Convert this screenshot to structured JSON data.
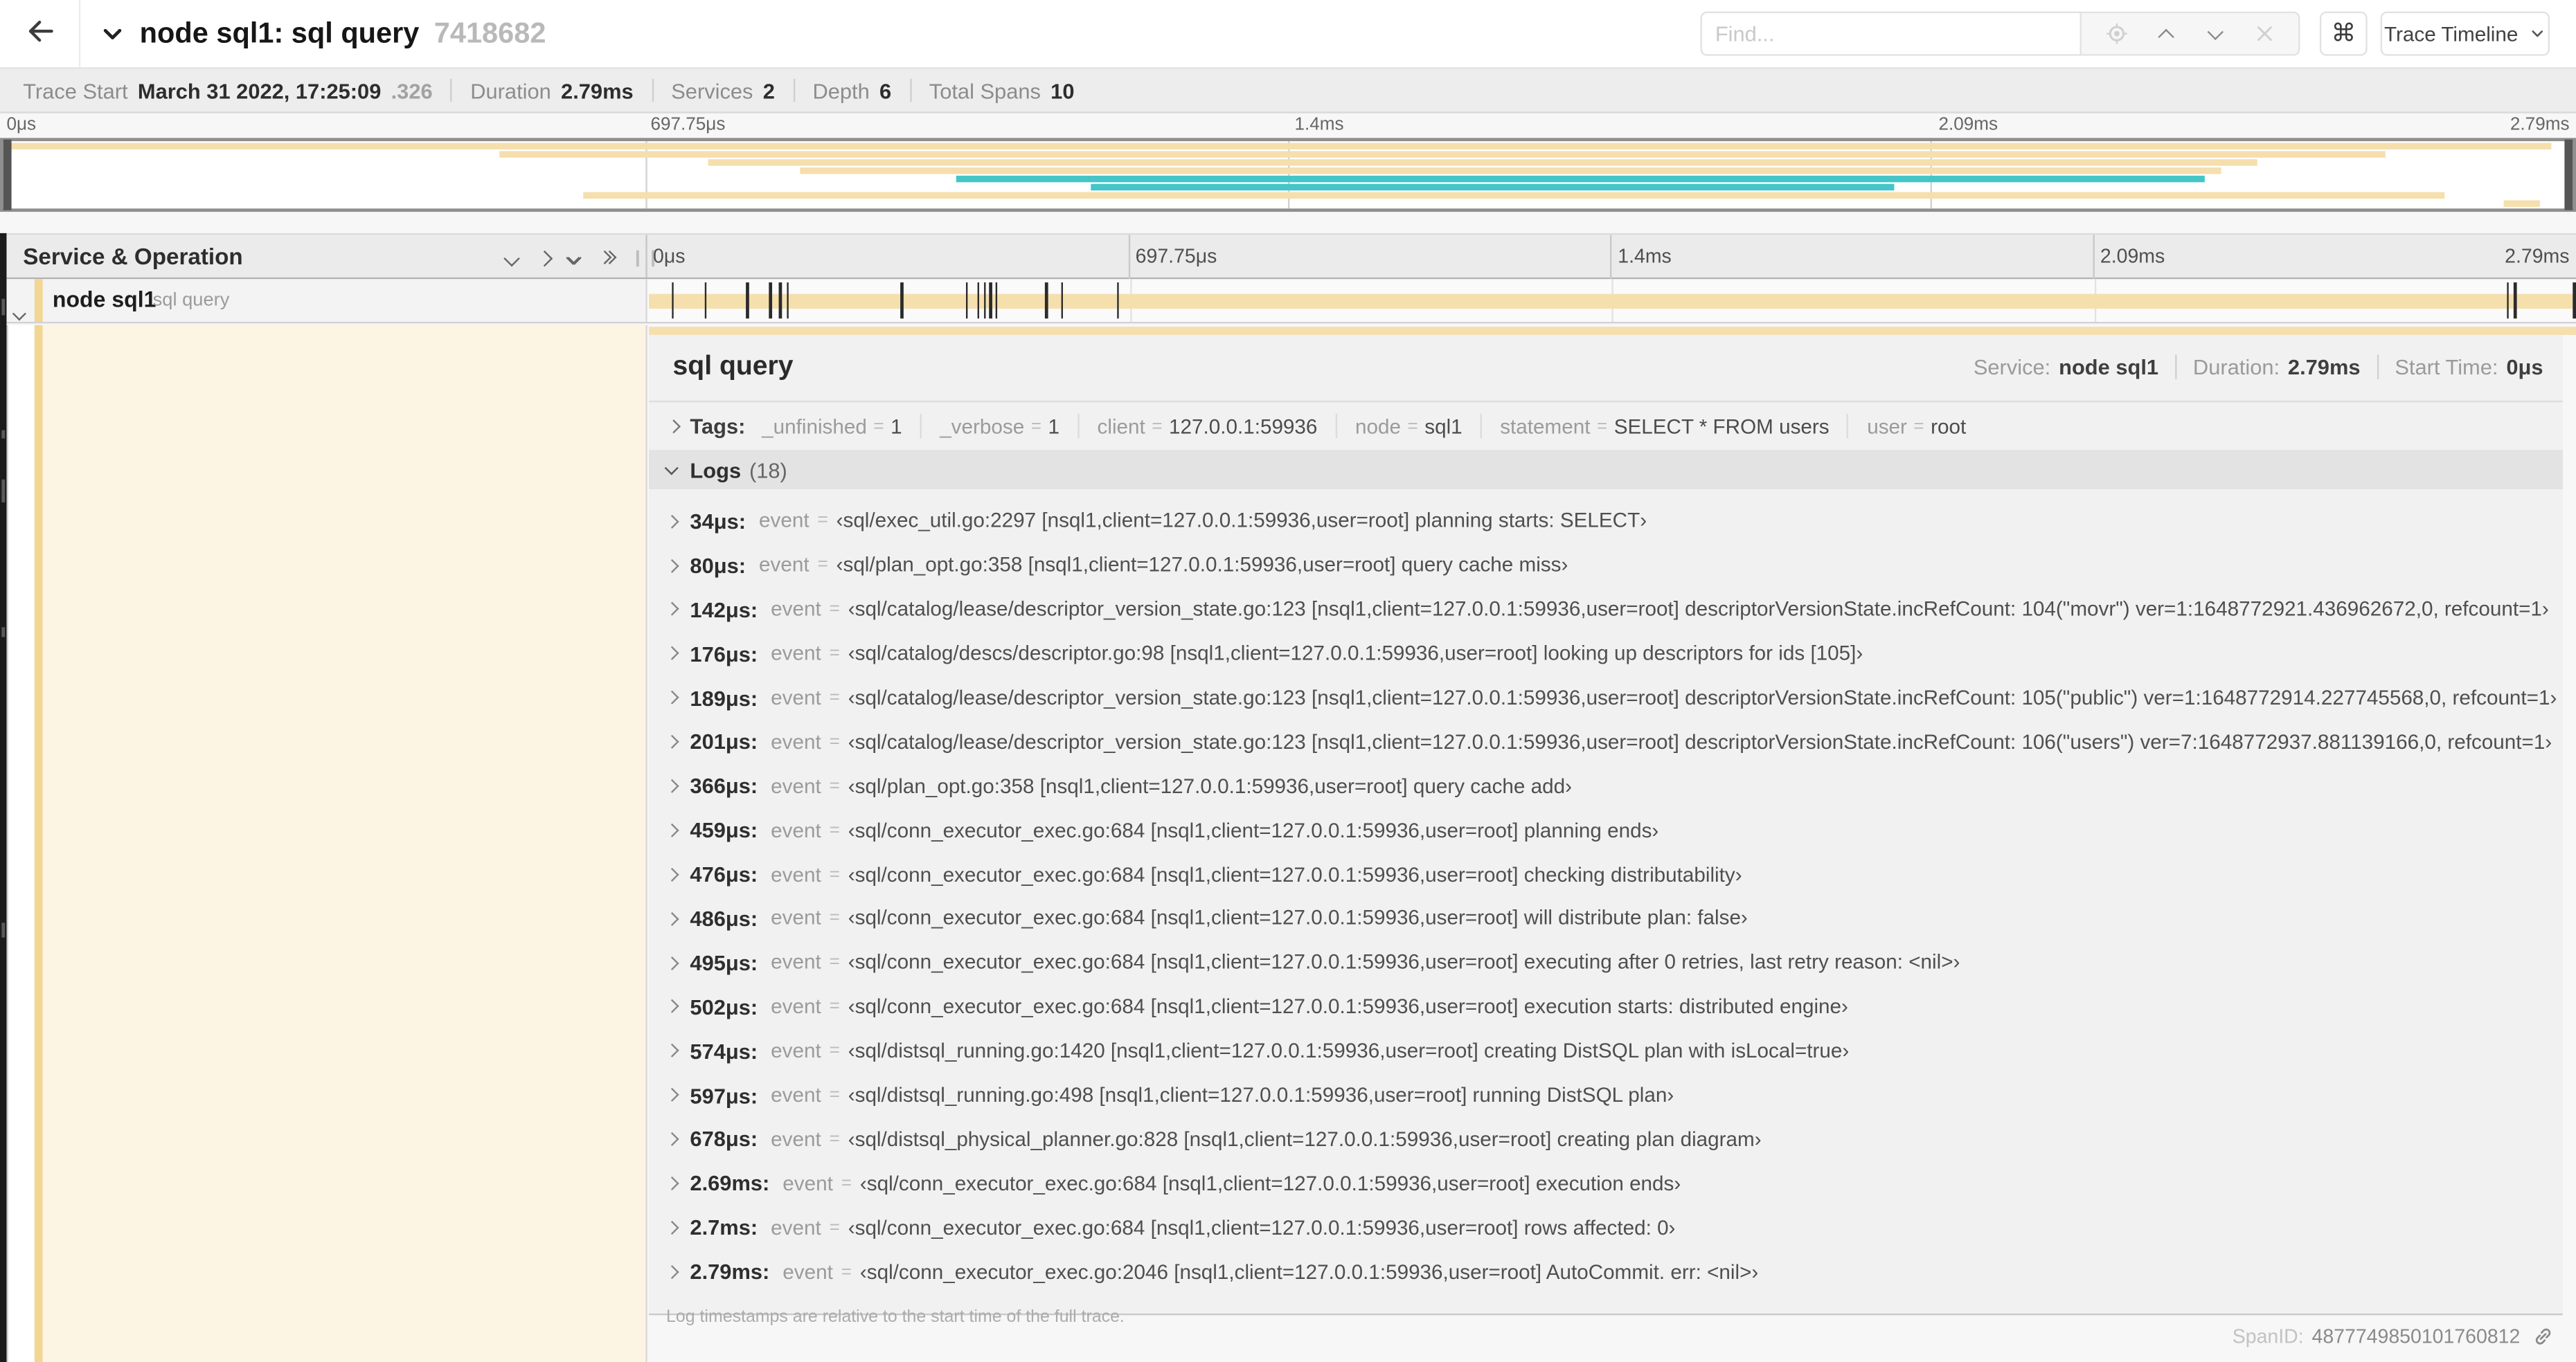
{
  "header": {
    "title": "node sql1: sql query",
    "trace_id_short": "7418682",
    "find_placeholder": "Find...",
    "shortcut_button": "⌘",
    "view_button": "Trace Timeline"
  },
  "summary": {
    "items": [
      {
        "label": "Trace Start",
        "value": "March 31 2022, 17:25:09",
        "suffix": ".326"
      },
      {
        "label": "Duration",
        "value": "2.79ms"
      },
      {
        "label": "Services",
        "value": "2"
      },
      {
        "label": "Depth",
        "value": "6"
      },
      {
        "label": "Total Spans",
        "value": "10"
      }
    ]
  },
  "ruler": {
    "ticks": [
      {
        "label": "0μs",
        "pct": 0
      },
      {
        "label": "697.75μs",
        "pct": 25
      },
      {
        "label": "1.4ms",
        "pct": 50
      },
      {
        "label": "2.09ms",
        "pct": 75
      },
      {
        "label": "2.79ms",
        "pct": 100
      }
    ]
  },
  "colors": {
    "span_tan": "#F5DFAD",
    "span_teal": "#45C5C7",
    "service_stripe": "#F2D694",
    "detail_cream": "#FDF5E3"
  },
  "minimap": {
    "bars": [
      {
        "row": 0,
        "start": 0,
        "end": 99.2,
        "color": "span_tan"
      },
      {
        "row": 1,
        "start": 19.3,
        "end": 92.7,
        "color": "span_tan"
      },
      {
        "row": 2,
        "start": 27.4,
        "end": 87.7,
        "color": "span_tan"
      },
      {
        "row": 3,
        "start": 31.0,
        "end": 86.3,
        "color": "span_tan"
      },
      {
        "row": 4,
        "start": 37.1,
        "end": 85.7,
        "color": "span_teal"
      },
      {
        "row": 5,
        "start": 42.3,
        "end": 73.6,
        "color": "span_teal"
      },
      {
        "row": 6,
        "start": 22.6,
        "end": 95.0,
        "color": "span_tan"
      },
      {
        "row": 7,
        "start": 97.3,
        "end": 98.7,
        "color": "span_tan"
      }
    ]
  },
  "columns_header": {
    "title": "Service & Operation"
  },
  "span_row": {
    "service": "node sql1",
    "operation": "sql query",
    "bar": {
      "start": 0,
      "end": 100
    },
    "log_tick_pcts": [
      1.2,
      2.9,
      5.1,
      6.3,
      6.8,
      7.2,
      13.1,
      16.5,
      17.1,
      17.4,
      17.7,
      18.0,
      20.6,
      21.4,
      24.3,
      96.4,
      96.8,
      99.85
    ]
  },
  "ui": {
    "eq": "="
  },
  "detail": {
    "title": "sql query",
    "meta": [
      {
        "label": "Service:",
        "value": "node sql1"
      },
      {
        "label": "Duration:",
        "value": "2.79ms"
      },
      {
        "label": "Start Time:",
        "value": "0μs"
      }
    ],
    "tags_label": "Tags:",
    "tags": [
      {
        "k": "_unfinished",
        "v": "1"
      },
      {
        "k": "_verbose",
        "v": "1"
      },
      {
        "k": "client",
        "v": "127.0.0.1:59936"
      },
      {
        "k": "node",
        "v": "sql1"
      },
      {
        "k": "statement",
        "v": "SELECT * FROM users"
      },
      {
        "k": "user",
        "v": "root"
      }
    ],
    "logs_label": "Logs",
    "logs_count": "(18)",
    "event_label": "event",
    "logs": [
      {
        "time": "34μs:",
        "event": "‹sql/exec_util.go:2297 [nsql1,client=127.0.0.1:59936,user=root] planning starts: SELECT›"
      },
      {
        "time": "80μs:",
        "event": "‹sql/plan_opt.go:358 [nsql1,client=127.0.0.1:59936,user=root] query cache miss›"
      },
      {
        "time": "142μs:",
        "event": "‹sql/catalog/lease/descriptor_version_state.go:123 [nsql1,client=127.0.0.1:59936,user=root] descriptorVersionState.incRefCount: 104(\"movr\") ver=1:1648772921.436962672,0, refcount=1›"
      },
      {
        "time": "176μs:",
        "event": "‹sql/catalog/descs/descriptor.go:98 [nsql1,client=127.0.0.1:59936,user=root] looking up descriptors for ids [105]›"
      },
      {
        "time": "189μs:",
        "event": "‹sql/catalog/lease/descriptor_version_state.go:123 [nsql1,client=127.0.0.1:59936,user=root] descriptorVersionState.incRefCount: 105(\"public\") ver=1:1648772914.227745568,0, refcount=1›"
      },
      {
        "time": "201μs:",
        "event": "‹sql/catalog/lease/descriptor_version_state.go:123 [nsql1,client=127.0.0.1:59936,user=root] descriptorVersionState.incRefCount: 106(\"users\") ver=7:1648772937.881139166,0, refcount=1›"
      },
      {
        "time": "366μs:",
        "event": "‹sql/plan_opt.go:358 [nsql1,client=127.0.0.1:59936,user=root] query cache add›"
      },
      {
        "time": "459μs:",
        "event": "‹sql/conn_executor_exec.go:684 [nsql1,client=127.0.0.1:59936,user=root] planning ends›"
      },
      {
        "time": "476μs:",
        "event": "‹sql/conn_executor_exec.go:684 [nsql1,client=127.0.0.1:59936,user=root] checking distributability›"
      },
      {
        "time": "486μs:",
        "event": "‹sql/conn_executor_exec.go:684 [nsql1,client=127.0.0.1:59936,user=root] will distribute plan: false›"
      },
      {
        "time": "495μs:",
        "event": "‹sql/conn_executor_exec.go:684 [nsql1,client=127.0.0.1:59936,user=root] executing after 0 retries, last retry reason: <nil>›"
      },
      {
        "time": "502μs:",
        "event": "‹sql/conn_executor_exec.go:684 [nsql1,client=127.0.0.1:59936,user=root] execution starts: distributed engine›"
      },
      {
        "time": "574μs:",
        "event": "‹sql/distsql_running.go:1420 [nsql1,client=127.0.0.1:59936,user=root] creating DistSQL plan with isLocal=true›"
      },
      {
        "time": "597μs:",
        "event": "‹sql/distsql_running.go:498 [nsql1,client=127.0.0.1:59936,user=root] running DistSQL plan›"
      },
      {
        "time": "678μs:",
        "event": "‹sql/distsql_physical_planner.go:828 [nsql1,client=127.0.0.1:59936,user=root] creating plan diagram›"
      },
      {
        "time": "2.69ms:",
        "event": "‹sql/conn_executor_exec.go:684 [nsql1,client=127.0.0.1:59936,user=root] execution ends›"
      },
      {
        "time": "2.7ms:",
        "event": "‹sql/conn_executor_exec.go:684 [nsql1,client=127.0.0.1:59936,user=root] rows affected: 0›"
      },
      {
        "time": "2.79ms:",
        "event": "‹sql/conn_executor_exec.go:2046 [nsql1,client=127.0.0.1:59936,user=root] AutoCommit. err: <nil>›"
      }
    ],
    "footer": "Log timestamps are relative to the start time of the full trace.",
    "spanid_label": "SpanID:",
    "spanid": "4877749850101760812"
  }
}
